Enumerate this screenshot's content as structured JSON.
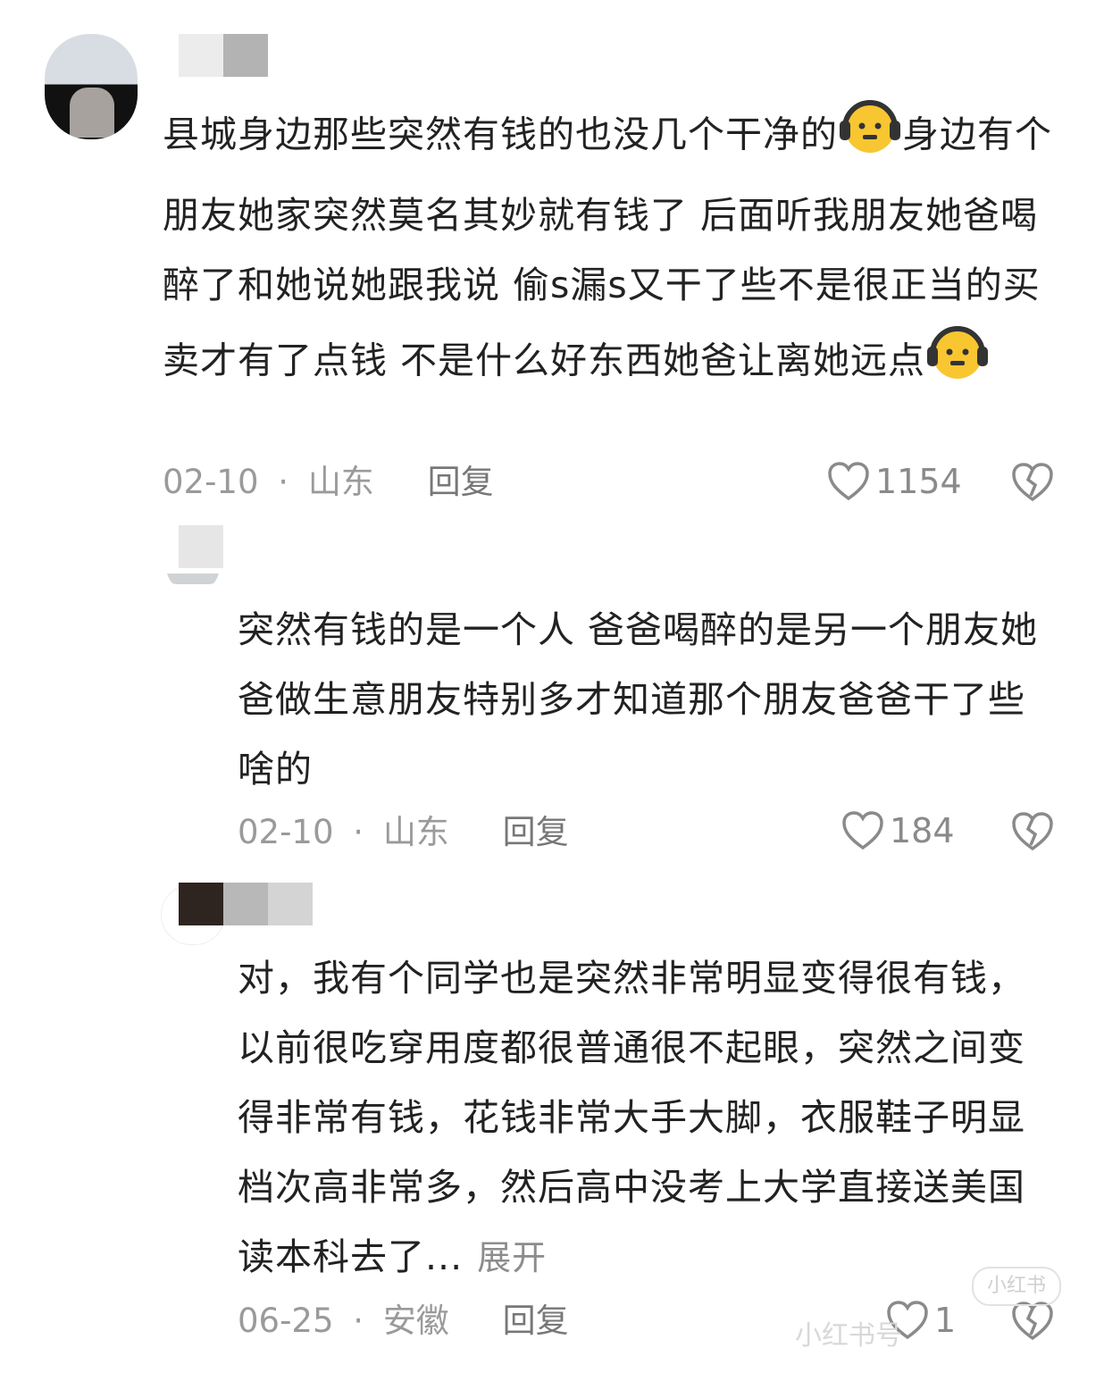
{
  "comments": [
    {
      "text": "县城身边那些突然有钱的也没几个干净的",
      "text_cont": "身边有个朋友她家突然莫名其妙就有钱了 后面听我朋友她爸喝醉了和她说她跟我说 偷s漏s又干了些不是很正当的买卖才有了点钱 不是什么好东西她爸让离她远点",
      "emoji": "headphones-face-emoji",
      "date": "02-10",
      "sep": "·",
      "location": "山东",
      "reply": "回复",
      "likes": "1154"
    },
    {
      "text": "突然有钱的是一个人 爸爸喝醉的是另一个朋友她爸做生意朋友特别多才知道那个朋友爸爸干了些啥的",
      "date": "02-10",
      "sep": "·",
      "location": "山东",
      "reply": "回复",
      "likes": "184"
    },
    {
      "text": "对，我有个同学也是突然非常明显变得很有钱，以前很吃穿用度都很普通很不起眼，突然之间变得非常有钱，花钱非常大手大脚，衣服鞋子明显档次高非常多，然后高中没考上大学直接送美国读本科去了...",
      "expand": "展开",
      "date": "06-25",
      "sep": "·",
      "location": "安徽",
      "reply": "回复",
      "likes": "1"
    }
  ],
  "watermark": {
    "badge": "小红书",
    "text": "小红书号"
  },
  "colors": {
    "text": "#222222",
    "meta": "#9a9a9a",
    "emoji": "#f7c631",
    "headphones": "#333333"
  }
}
